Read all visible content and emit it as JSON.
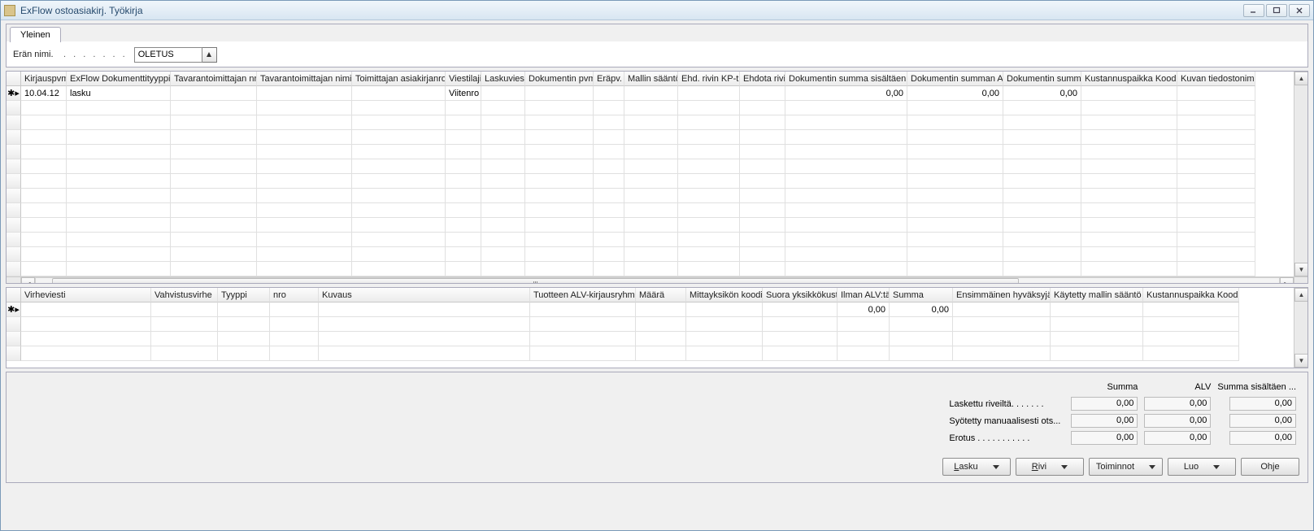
{
  "window": {
    "title": "ExFlow ostoasiakirj. Työkirja"
  },
  "tab": {
    "label": "Yleinen"
  },
  "batch": {
    "label": "Erän nimi.",
    "dots": ". . . . . . .",
    "value": "OLETUS"
  },
  "grid1": {
    "headers": [
      "Kirjauspvm.",
      "ExFlow Dokumenttityyppi",
      "Tavarantoimittajan nro",
      "Tavarantoimittajan nimi",
      "Toimittajan asiakirjanro",
      "Viestilaji",
      "Laskuviesti",
      "Dokumentin pvm.",
      "Eräpv.",
      "Mallin sääntö",
      "Ehd. rivin KP-tili",
      "Ehdota rivi",
      "Dokumentin summa sisältäen ALV",
      "Dokumentin summan ALV",
      "Dokumentin summa",
      "Kustannuspaikka Koodi",
      "Kuvan tiedostonimi"
    ],
    "row": {
      "kirjauspvm": "10.04.12",
      "doktyyppi": "lasku",
      "viestilaji": "Viitenro",
      "dok_summa_alv_incl": "0,00",
      "dok_summan_alv": "0,00",
      "dok_summa": "0,00"
    }
  },
  "grid2": {
    "headers": [
      "Virheviesti",
      "Vahvistusvirhe",
      "Tyyppi",
      "nro",
      "Kuvaus",
      "Tuotteen ALV-kirjausryhmä",
      "Määrä",
      "Mittayksikön koodi",
      "Suora yksikkökust.",
      "Ilman ALV:tä",
      "Summa",
      "Ensimmäinen hyväksyjä",
      "Käytetty mallin sääntö",
      "Kustannuspaikka Koodi"
    ],
    "row": {
      "ilman_alv": "0,00",
      "summa": "0,00"
    }
  },
  "summary": {
    "col_headers": {
      "summa": "Summa",
      "alv": "ALV",
      "summa_incl": "Summa sisältäen ..."
    },
    "rows": [
      {
        "label": "Laskettu riveiltä. . . . . . .",
        "summa": "0,00",
        "alv": "0,00",
        "incl": "0,00"
      },
      {
        "label": "Syötetty manuaalisesti ots...",
        "summa": "0,00",
        "alv": "0,00",
        "incl": "0,00"
      },
      {
        "label": "Erotus . . . . . . . . . . .",
        "summa": "0,00",
        "alv": "0,00",
        "incl": "0,00"
      }
    ]
  },
  "buttons": {
    "lasku": "Lasku",
    "rivi": "Rivi",
    "toiminnot": "Toiminnot",
    "luo": "Luo",
    "ohje": "Ohje"
  }
}
